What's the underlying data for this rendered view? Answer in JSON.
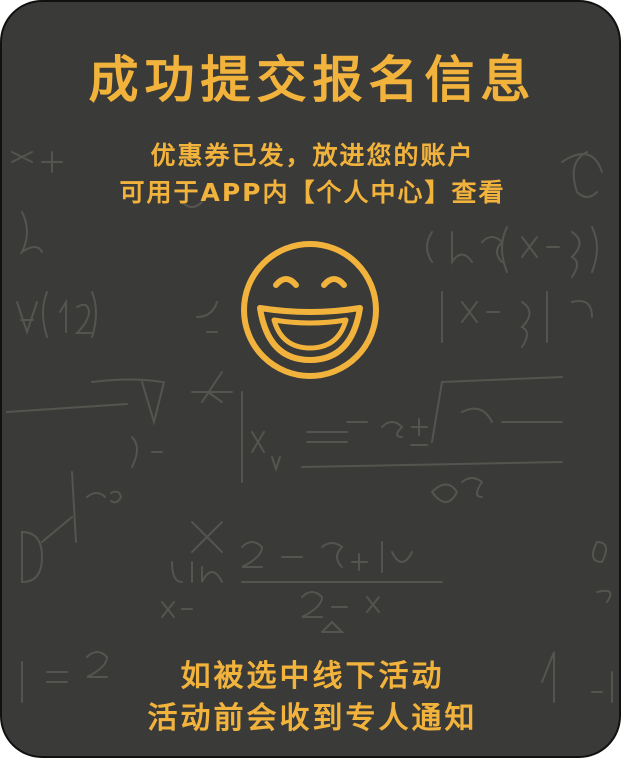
{
  "success_card": {
    "title": "成功提交报名信息",
    "subtitle_line1": "优惠券已发，放进您的账户",
    "subtitle_line2": "可用于APP内【个人中心】查看",
    "icon": "smiley-face-icon",
    "footer_line1": "如被选中线下活动",
    "footer_line2": "活动前会收到专人通知"
  },
  "colors": {
    "background": "#3a3a38",
    "accent": "#f2b33d",
    "chalk": "#5c5b55"
  }
}
